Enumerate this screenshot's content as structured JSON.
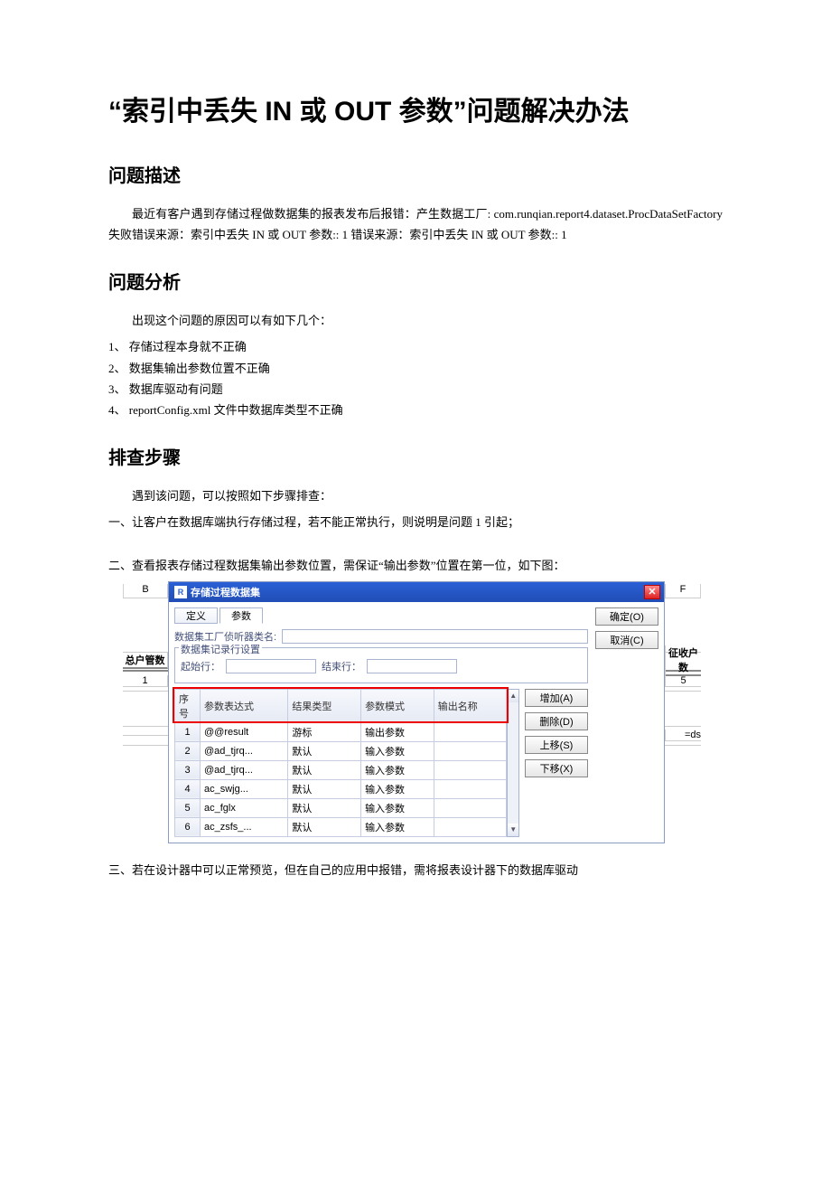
{
  "title": "“索引中丢失 IN 或 OUT 参数”问题解决办法",
  "sections": {
    "desc_h": "问题描述",
    "desc_p": "最近有客户遇到存储过程做数据集的报表发布后报错：产生数据工厂: com.runqian.report4.dataset.ProcDataSetFactory 失败错误来源：索引中丢失 IN 或 OUT 参数:: 1 错误来源：索引中丢失 IN 或 OUT 参数:: 1",
    "ana_h": "问题分析",
    "ana_intro": "出现这个问题的原因可以有如下几个：",
    "ana_items": [
      "1、 存储过程本身就不正确",
      "2、 数据集输出参数位置不正确",
      "3、 数据库驱动有问题",
      "4、 reportConfig.xml 文件中数据库类型不正确"
    ],
    "steps_h": "排查步骤",
    "steps_intro": "遇到该问题，可以按照如下步骤排查：",
    "steps": [
      "一、让客户在数据库端执行存储过程，若不能正常执行，则说明是问题 1 引起；",
      "二、查看报表存储过程数据集输出参数位置，需保证“输出参数”位置在第一位，如下图：",
      "三、若在设计器中可以正常预览，但在自己的应用中报错，需将报表设计器下的数据库驱动"
    ]
  },
  "ui": {
    "bg_col_b": "B",
    "bg_col_f": "F",
    "bg_left_label": "总户管数",
    "bg_left_val": "1",
    "bg_right_label": "征收户数",
    "bg_right_val": "5",
    "bg_right_formula": "=ds",
    "dialog_title": "存储过程数据集",
    "tabs": {
      "def": "定义",
      "params": "参数"
    },
    "ok": "确定(O)",
    "cancel": "取消(C)",
    "listener_label": "数据集工厂侦听器类名:",
    "rowset_legend": "数据集记录行设置",
    "start_row": "起始行：",
    "end_row": "结束行：",
    "grid_headers": [
      "序号",
      "参数表达式",
      "结果类型",
      "参数模式",
      "输出名称"
    ],
    "grid_rows": [
      {
        "n": "1",
        "expr": "@@result",
        "rtype": "游标",
        "mode": "输出参数",
        "out": ""
      },
      {
        "n": "2",
        "expr": "@ad_tjrq...",
        "rtype": "默认",
        "mode": "输入参数",
        "out": ""
      },
      {
        "n": "3",
        "expr": "@ad_tjrq...",
        "rtype": "默认",
        "mode": "输入参数",
        "out": ""
      },
      {
        "n": "4",
        "expr": "ac_swjg...",
        "rtype": "默认",
        "mode": "输入参数",
        "out": ""
      },
      {
        "n": "5",
        "expr": "ac_fglx",
        "rtype": "默认",
        "mode": "输入参数",
        "out": ""
      },
      {
        "n": "6",
        "expr": "ac_zsfs_...",
        "rtype": "默认",
        "mode": "输入参数",
        "out": ""
      }
    ],
    "btn_add": "增加(A)",
    "btn_del": "删除(D)",
    "btn_up": "上移(S)",
    "btn_down": "下移(X)"
  }
}
